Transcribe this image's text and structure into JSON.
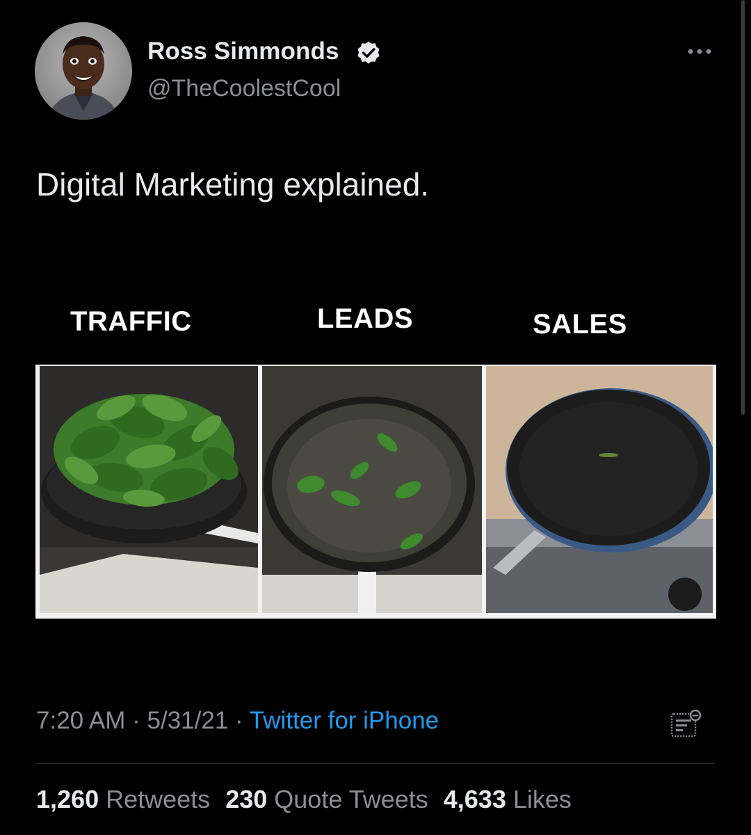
{
  "tweet": {
    "author": {
      "display_name": "Ross Simmonds",
      "handle": "@TheCoolestCool",
      "verified": true,
      "avatar": "profile-photo"
    },
    "more_icon": "ellipsis-icon",
    "text": "Digital Marketing explained.",
    "media": {
      "panels": [
        {
          "title": "TRAFFIC",
          "image": "pan full of spinach"
        },
        {
          "title": "LEADS",
          "image": "pan with a few spinach leaves"
        },
        {
          "title": "SALES",
          "image": "nearly empty pan"
        }
      ]
    },
    "meta": {
      "time": "7:20 AM",
      "separator": " · ",
      "date": "5/31/21",
      "source": "Twitter for iPhone",
      "analytics_icon": "analytics-icon"
    },
    "stats": {
      "retweets": {
        "count": "1,260",
        "label": "Retweets"
      },
      "quotes": {
        "count": "230",
        "label": "Quote Tweets"
      },
      "likes": {
        "count": "4,633",
        "label": "Likes"
      }
    }
  },
  "colors": {
    "background": "#000000",
    "text": "#e7e9ea",
    "secondary": "#8b8f93",
    "link": "#1d9bf0",
    "verified_badge": "#e7e9ea"
  }
}
